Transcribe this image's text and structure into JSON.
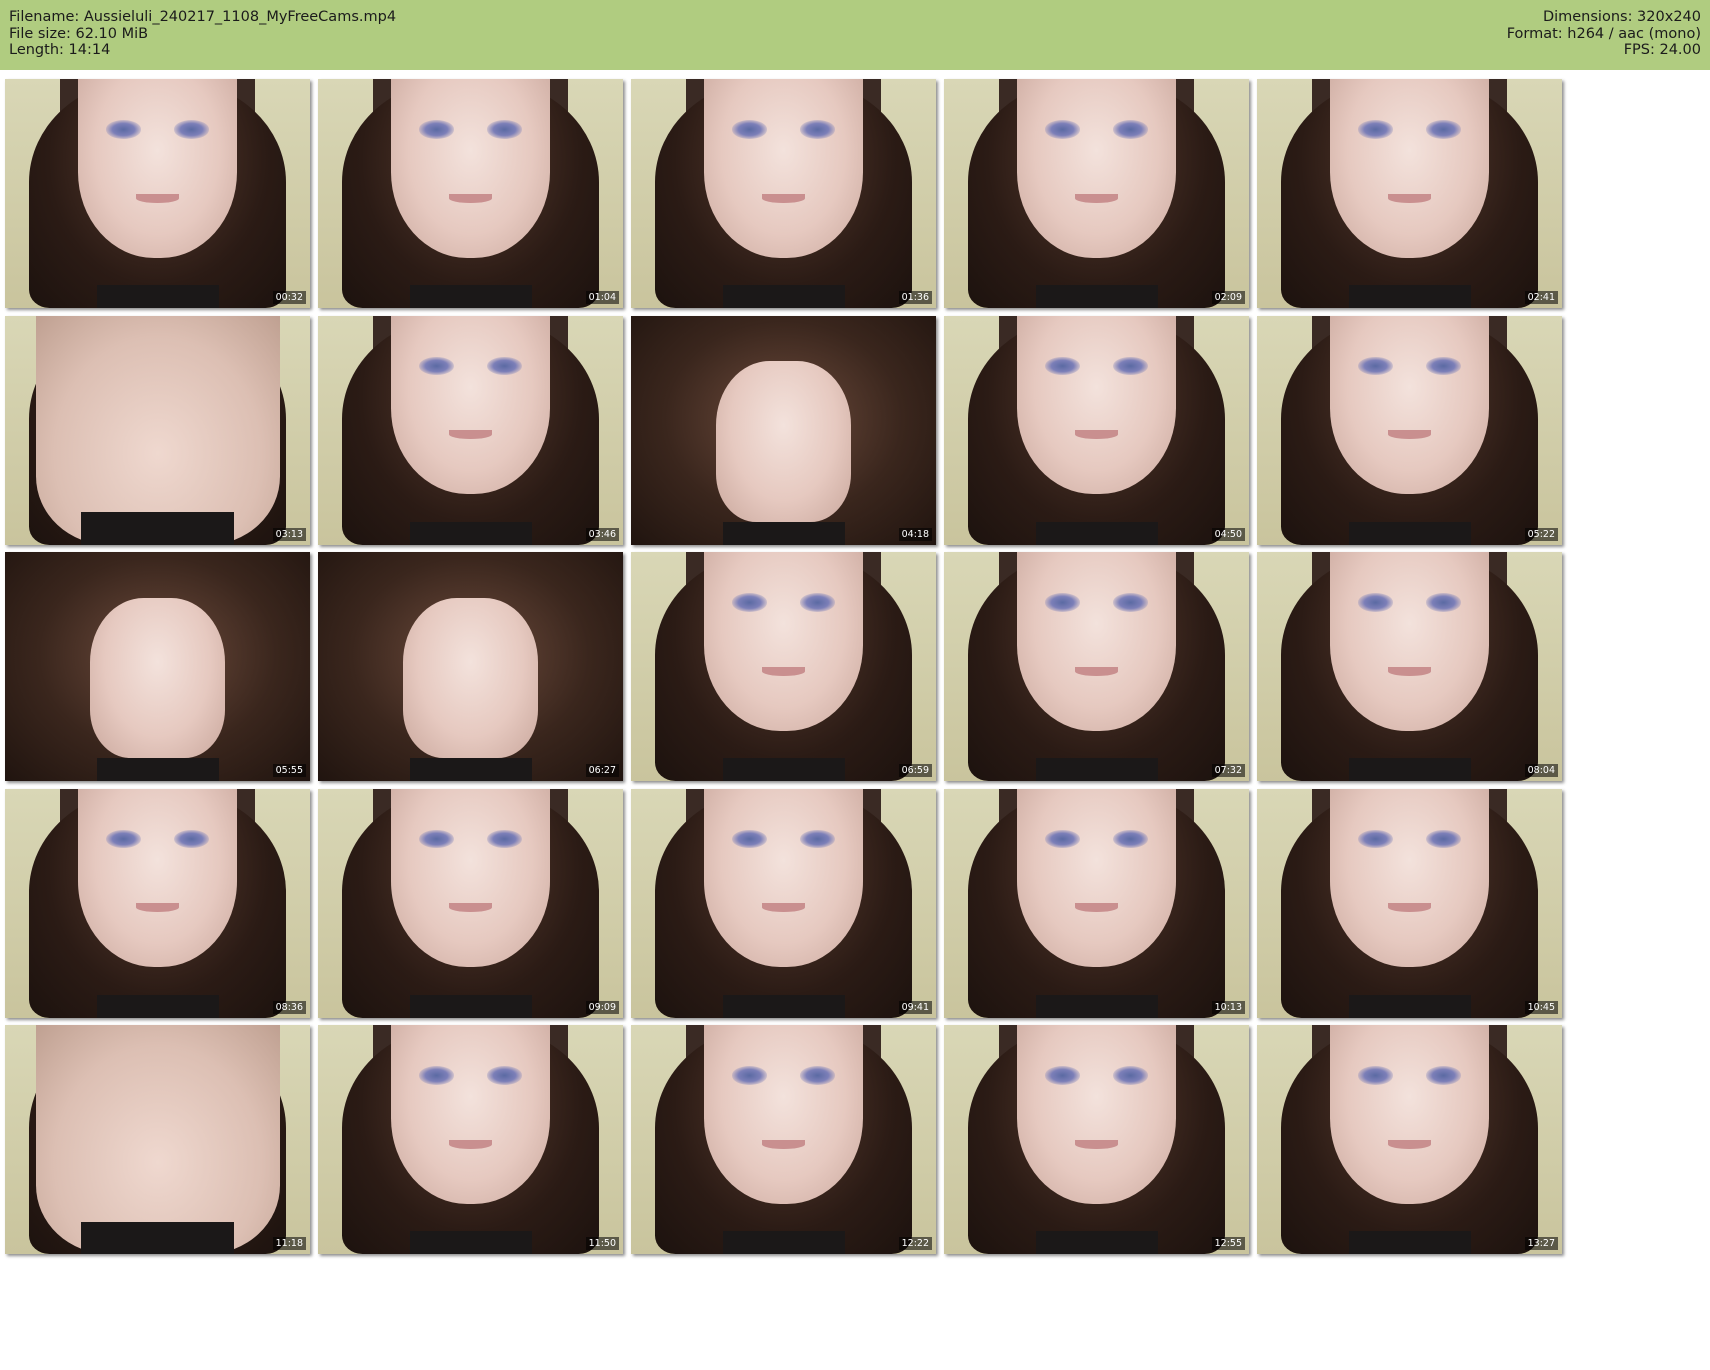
{
  "header": {
    "left": [
      "Filename: Aussieluli_240217_1108_MyFreeCams.mp4",
      "File size: 62.10 MiB",
      "Length: 14:14"
    ],
    "right": [
      "Dimensions: 320x240",
      "Format: h264 / aac (mono)",
      "FPS: 24.00"
    ]
  },
  "colors": {
    "header_background": "#b0cc80",
    "page_background": "#ffffff",
    "timestamp_text": "#ffffff"
  },
  "thumbnails": [
    {
      "time": "00:32",
      "variant": "face"
    },
    {
      "time": "01:04",
      "variant": "face"
    },
    {
      "time": "01:36",
      "variant": "face"
    },
    {
      "time": "02:09",
      "variant": "face"
    },
    {
      "time": "02:41",
      "variant": "face"
    },
    {
      "time": "03:13",
      "variant": "body"
    },
    {
      "time": "03:46",
      "variant": "face"
    },
    {
      "time": "04:18",
      "variant": "hair"
    },
    {
      "time": "04:50",
      "variant": "face"
    },
    {
      "time": "05:22",
      "variant": "face"
    },
    {
      "time": "05:55",
      "variant": "hair"
    },
    {
      "time": "06:27",
      "variant": "hair"
    },
    {
      "time": "06:59",
      "variant": "face"
    },
    {
      "time": "07:32",
      "variant": "face"
    },
    {
      "time": "08:04",
      "variant": "face"
    },
    {
      "time": "08:36",
      "variant": "face"
    },
    {
      "time": "09:09",
      "variant": "face"
    },
    {
      "time": "09:41",
      "variant": "face"
    },
    {
      "time": "10:13",
      "variant": "face"
    },
    {
      "time": "10:45",
      "variant": "face"
    },
    {
      "time": "11:18",
      "variant": "body"
    },
    {
      "time": "11:50",
      "variant": "face"
    },
    {
      "time": "12:22",
      "variant": "face"
    },
    {
      "time": "12:55",
      "variant": "face"
    },
    {
      "time": "13:27",
      "variant": "face"
    }
  ]
}
